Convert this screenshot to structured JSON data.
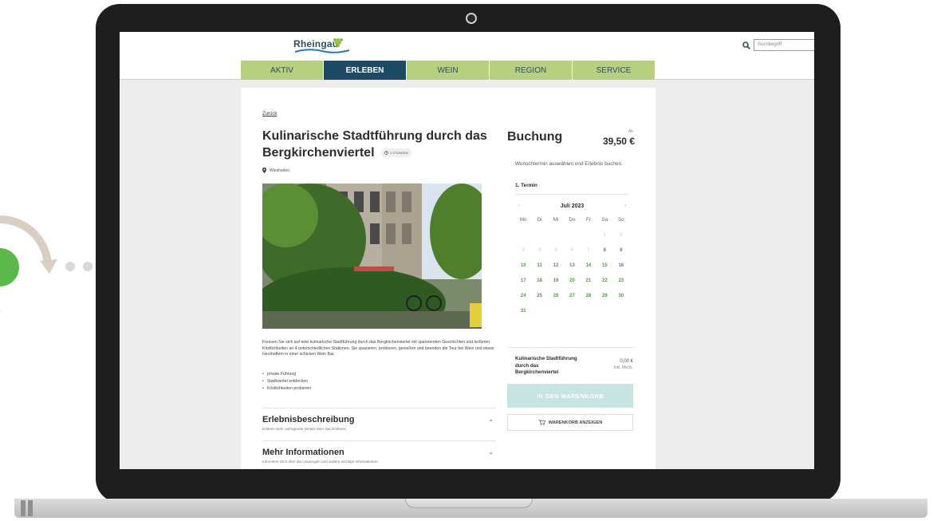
{
  "header": {
    "logo_text": "Rheingau",
    "search_placeholder": "Suchbegriff"
  },
  "nav": {
    "items": [
      {
        "label": "AKTIV"
      },
      {
        "label": "ERLEBEN",
        "active": true
      },
      {
        "label": "WEIN"
      },
      {
        "label": "REGION"
      },
      {
        "label": "SERVICE"
      }
    ]
  },
  "content": {
    "back_link": "Zurück",
    "title": "Kulinarische Stadtführung durch das Bergkirchenviertel",
    "duration_badge": "2 STUNDEN",
    "location": "Wiesbaden",
    "description": "Fressen Sie sich auf eine kulinarische Stadtführung durch das Bergkirchenviertel mit spannenden Geschichten und leckeren Köstlichkeiten an 4 unterschiedlichen Stationen. Sie spazieren, probieren, genießen und beenden die Tour bei Wein und etwas Herzhaftem in einer schicken Wein Bar.",
    "bullets": [
      "private Führung",
      "Stadtviertel entdecken",
      "Köstlichkeiten probieren"
    ],
    "accordions": [
      {
        "title": "Erlebnisbeschreibung",
        "subtitle": "Erfahre mehr aufregende Details über das Erlebnis!"
      },
      {
        "title": "Mehr Informationen",
        "subtitle": "Informiere Dich über die Leistungen und andere wichtige Informationen."
      }
    ]
  },
  "booking": {
    "title": "Buchung",
    "price_prefix": "Ab",
    "price": "39,50 €",
    "instruction": "Wunschtermin auswählen und Erlebnis buchen.",
    "step_label": "1. Termin",
    "calendar": {
      "month": "Juli 2023",
      "prev": "‹",
      "next": "›",
      "weekdays": [
        "Mo",
        "Di",
        "Mi",
        "Do",
        "Fr",
        "Sa",
        "So"
      ],
      "leading_blanks": 5,
      "days": [
        {
          "d": "1",
          "state": "disabled"
        },
        {
          "d": "2",
          "state": "disabled"
        },
        {
          "d": "3",
          "state": "disabled"
        },
        {
          "d": "4",
          "state": "disabled"
        },
        {
          "d": "5",
          "state": "disabled"
        },
        {
          "d": "6",
          "state": "disabled"
        },
        {
          "d": "7",
          "state": "disabled"
        },
        {
          "d": "8",
          "state": "available"
        },
        {
          "d": "9",
          "state": "available"
        },
        {
          "d": "10",
          "state": "available"
        },
        {
          "d": "11",
          "state": "available"
        },
        {
          "d": "12",
          "state": "available"
        },
        {
          "d": "13",
          "state": "available"
        },
        {
          "d": "14",
          "state": "available"
        },
        {
          "d": "15",
          "state": "available"
        },
        {
          "d": "16",
          "state": "available"
        },
        {
          "d": "17",
          "state": "available"
        },
        {
          "d": "18",
          "state": "available"
        },
        {
          "d": "19",
          "state": "available"
        },
        {
          "d": "20",
          "state": "available"
        },
        {
          "d": "21",
          "state": "available"
        },
        {
          "d": "22",
          "state": "available"
        },
        {
          "d": "23",
          "state": "available"
        },
        {
          "d": "24",
          "state": "available"
        },
        {
          "d": "25",
          "state": "available"
        },
        {
          "d": "26",
          "state": "available"
        },
        {
          "d": "27",
          "state": "available"
        },
        {
          "d": "28",
          "state": "available"
        },
        {
          "d": "29",
          "state": "available"
        },
        {
          "d": "30",
          "state": "available"
        },
        {
          "d": "31",
          "state": "available"
        }
      ]
    },
    "summary": {
      "name": "Kulinarische Stadtführung durch das Bergkirchenviertel",
      "price": "0,00 €",
      "tax": "inkl. MwSt."
    },
    "add_to_cart_label": "IN DEN WARENKORB",
    "show_cart_label": "WARENKORB ANZEIGEN"
  },
  "colors": {
    "nav_green": "#b6cf80",
    "nav_active": "#1d4a65",
    "available_day": "#4e9a41",
    "cart_button": "#c6e4e2"
  }
}
